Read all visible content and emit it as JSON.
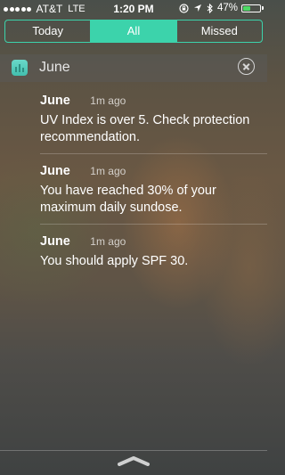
{
  "status_bar": {
    "signal_dots": 5,
    "carrier": "AT&T",
    "network": "LTE",
    "time": "1:20 PM",
    "battery_percent": "47%",
    "battery_level": 0.47,
    "battery_color": "#4cd964",
    "icons": [
      "lock-rotation-icon",
      "location-icon",
      "bluetooth-icon"
    ]
  },
  "tabs": [
    {
      "label": "Today",
      "active": false
    },
    {
      "label": "All",
      "active": true
    },
    {
      "label": "Missed",
      "active": false
    }
  ],
  "accent_color": "#3cd3ab",
  "app_header": {
    "name": "June",
    "icon": "june-app-icon",
    "close_icon": "close-circle-icon"
  },
  "notifications": [
    {
      "title": "June",
      "time": "1m ago",
      "body": "UV Index is over 5. Check protection recommendation."
    },
    {
      "title": "June",
      "time": "1m ago",
      "body": "You have reached 30% of your maximum daily sundose."
    },
    {
      "title": "June",
      "time": "1m ago",
      "body": "You should apply SPF 30."
    }
  ],
  "bottom": {
    "grabber_icon": "chevron-up-handle-icon"
  }
}
